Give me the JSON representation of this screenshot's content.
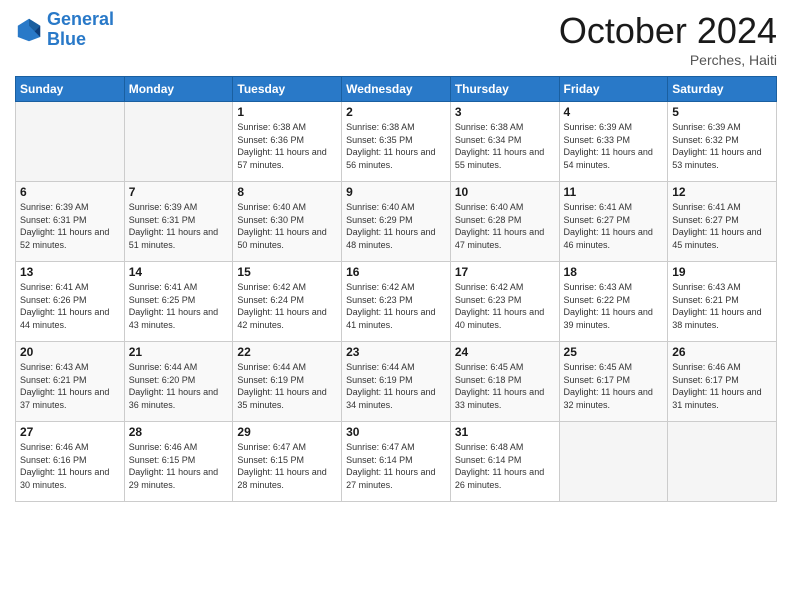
{
  "logo": {
    "line1": "General",
    "line2": "Blue"
  },
  "title": "October 2024",
  "location": "Perches, Haiti",
  "days_of_week": [
    "Sunday",
    "Monday",
    "Tuesday",
    "Wednesday",
    "Thursday",
    "Friday",
    "Saturday"
  ],
  "weeks": [
    [
      {
        "day": "",
        "sunrise": "",
        "sunset": "",
        "daylight": ""
      },
      {
        "day": "",
        "sunrise": "",
        "sunset": "",
        "daylight": ""
      },
      {
        "day": "1",
        "sunrise": "Sunrise: 6:38 AM",
        "sunset": "Sunset: 6:36 PM",
        "daylight": "Daylight: 11 hours and 57 minutes."
      },
      {
        "day": "2",
        "sunrise": "Sunrise: 6:38 AM",
        "sunset": "Sunset: 6:35 PM",
        "daylight": "Daylight: 11 hours and 56 minutes."
      },
      {
        "day": "3",
        "sunrise": "Sunrise: 6:38 AM",
        "sunset": "Sunset: 6:34 PM",
        "daylight": "Daylight: 11 hours and 55 minutes."
      },
      {
        "day": "4",
        "sunrise": "Sunrise: 6:39 AM",
        "sunset": "Sunset: 6:33 PM",
        "daylight": "Daylight: 11 hours and 54 minutes."
      },
      {
        "day": "5",
        "sunrise": "Sunrise: 6:39 AM",
        "sunset": "Sunset: 6:32 PM",
        "daylight": "Daylight: 11 hours and 53 minutes."
      }
    ],
    [
      {
        "day": "6",
        "sunrise": "Sunrise: 6:39 AM",
        "sunset": "Sunset: 6:31 PM",
        "daylight": "Daylight: 11 hours and 52 minutes."
      },
      {
        "day": "7",
        "sunrise": "Sunrise: 6:39 AM",
        "sunset": "Sunset: 6:31 PM",
        "daylight": "Daylight: 11 hours and 51 minutes."
      },
      {
        "day": "8",
        "sunrise": "Sunrise: 6:40 AM",
        "sunset": "Sunset: 6:30 PM",
        "daylight": "Daylight: 11 hours and 50 minutes."
      },
      {
        "day": "9",
        "sunrise": "Sunrise: 6:40 AM",
        "sunset": "Sunset: 6:29 PM",
        "daylight": "Daylight: 11 hours and 48 minutes."
      },
      {
        "day": "10",
        "sunrise": "Sunrise: 6:40 AM",
        "sunset": "Sunset: 6:28 PM",
        "daylight": "Daylight: 11 hours and 47 minutes."
      },
      {
        "day": "11",
        "sunrise": "Sunrise: 6:41 AM",
        "sunset": "Sunset: 6:27 PM",
        "daylight": "Daylight: 11 hours and 46 minutes."
      },
      {
        "day": "12",
        "sunrise": "Sunrise: 6:41 AM",
        "sunset": "Sunset: 6:27 PM",
        "daylight": "Daylight: 11 hours and 45 minutes."
      }
    ],
    [
      {
        "day": "13",
        "sunrise": "Sunrise: 6:41 AM",
        "sunset": "Sunset: 6:26 PM",
        "daylight": "Daylight: 11 hours and 44 minutes."
      },
      {
        "day": "14",
        "sunrise": "Sunrise: 6:41 AM",
        "sunset": "Sunset: 6:25 PM",
        "daylight": "Daylight: 11 hours and 43 minutes."
      },
      {
        "day": "15",
        "sunrise": "Sunrise: 6:42 AM",
        "sunset": "Sunset: 6:24 PM",
        "daylight": "Daylight: 11 hours and 42 minutes."
      },
      {
        "day": "16",
        "sunrise": "Sunrise: 6:42 AM",
        "sunset": "Sunset: 6:23 PM",
        "daylight": "Daylight: 11 hours and 41 minutes."
      },
      {
        "day": "17",
        "sunrise": "Sunrise: 6:42 AM",
        "sunset": "Sunset: 6:23 PM",
        "daylight": "Daylight: 11 hours and 40 minutes."
      },
      {
        "day": "18",
        "sunrise": "Sunrise: 6:43 AM",
        "sunset": "Sunset: 6:22 PM",
        "daylight": "Daylight: 11 hours and 39 minutes."
      },
      {
        "day": "19",
        "sunrise": "Sunrise: 6:43 AM",
        "sunset": "Sunset: 6:21 PM",
        "daylight": "Daylight: 11 hours and 38 minutes."
      }
    ],
    [
      {
        "day": "20",
        "sunrise": "Sunrise: 6:43 AM",
        "sunset": "Sunset: 6:21 PM",
        "daylight": "Daylight: 11 hours and 37 minutes."
      },
      {
        "day": "21",
        "sunrise": "Sunrise: 6:44 AM",
        "sunset": "Sunset: 6:20 PM",
        "daylight": "Daylight: 11 hours and 36 minutes."
      },
      {
        "day": "22",
        "sunrise": "Sunrise: 6:44 AM",
        "sunset": "Sunset: 6:19 PM",
        "daylight": "Daylight: 11 hours and 35 minutes."
      },
      {
        "day": "23",
        "sunrise": "Sunrise: 6:44 AM",
        "sunset": "Sunset: 6:19 PM",
        "daylight": "Daylight: 11 hours and 34 minutes."
      },
      {
        "day": "24",
        "sunrise": "Sunrise: 6:45 AM",
        "sunset": "Sunset: 6:18 PM",
        "daylight": "Daylight: 11 hours and 33 minutes."
      },
      {
        "day": "25",
        "sunrise": "Sunrise: 6:45 AM",
        "sunset": "Sunset: 6:17 PM",
        "daylight": "Daylight: 11 hours and 32 minutes."
      },
      {
        "day": "26",
        "sunrise": "Sunrise: 6:46 AM",
        "sunset": "Sunset: 6:17 PM",
        "daylight": "Daylight: 11 hours and 31 minutes."
      }
    ],
    [
      {
        "day": "27",
        "sunrise": "Sunrise: 6:46 AM",
        "sunset": "Sunset: 6:16 PM",
        "daylight": "Daylight: 11 hours and 30 minutes."
      },
      {
        "day": "28",
        "sunrise": "Sunrise: 6:46 AM",
        "sunset": "Sunset: 6:15 PM",
        "daylight": "Daylight: 11 hours and 29 minutes."
      },
      {
        "day": "29",
        "sunrise": "Sunrise: 6:47 AM",
        "sunset": "Sunset: 6:15 PM",
        "daylight": "Daylight: 11 hours and 28 minutes."
      },
      {
        "day": "30",
        "sunrise": "Sunrise: 6:47 AM",
        "sunset": "Sunset: 6:14 PM",
        "daylight": "Daylight: 11 hours and 27 minutes."
      },
      {
        "day": "31",
        "sunrise": "Sunrise: 6:48 AM",
        "sunset": "Sunset: 6:14 PM",
        "daylight": "Daylight: 11 hours and 26 minutes."
      },
      {
        "day": "",
        "sunrise": "",
        "sunset": "",
        "daylight": ""
      },
      {
        "day": "",
        "sunrise": "",
        "sunset": "",
        "daylight": ""
      }
    ]
  ]
}
